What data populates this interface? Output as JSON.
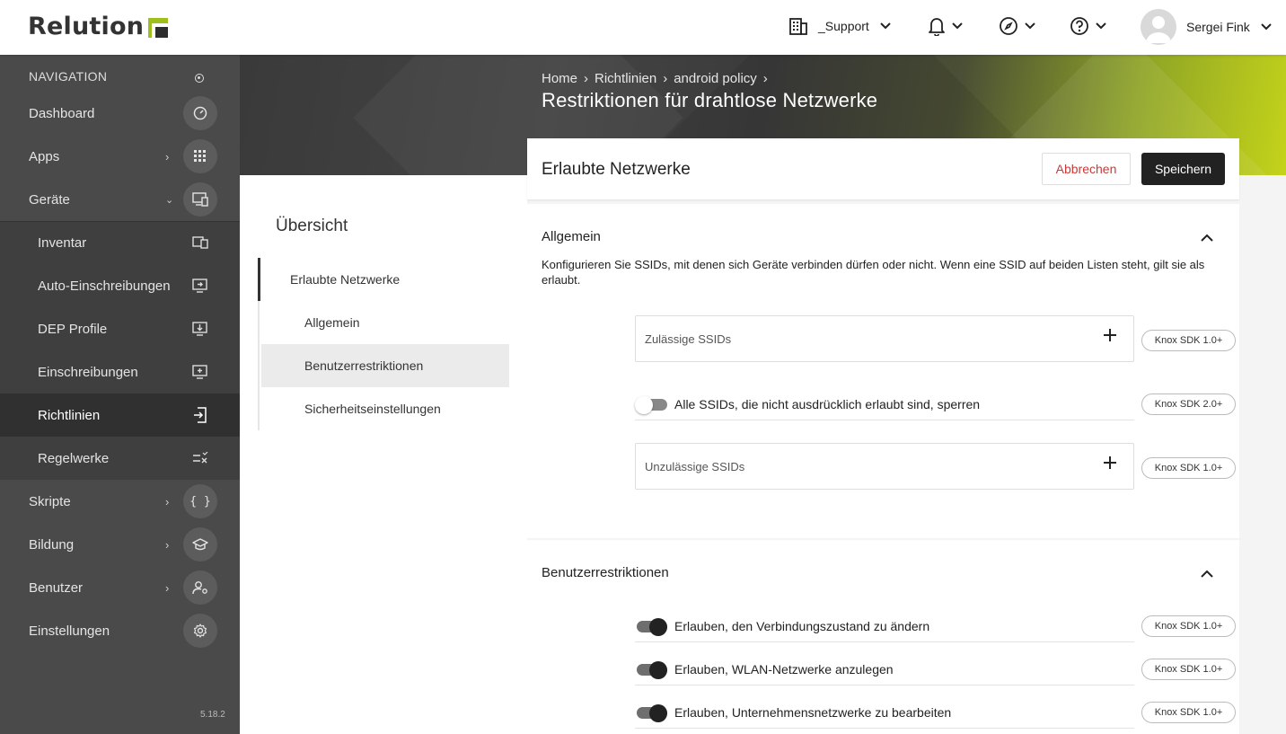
{
  "app": {
    "logo_text": "Relution",
    "version": "5.18.2"
  },
  "topbar": {
    "org_label": "_Support",
    "user_name": "Sergei Fink",
    "icons": [
      "building-icon",
      "bell-icon",
      "compass-icon",
      "help-icon",
      "avatar"
    ]
  },
  "sidebar": {
    "heading": "NAVIGATION",
    "items": [
      {
        "label": "Dashboard",
        "icon": "gauge-icon"
      },
      {
        "label": "Apps",
        "icon": "grid-icon"
      },
      {
        "label": "Geräte",
        "icon": "devices-icon"
      },
      {
        "label": "Inventar",
        "icon": "inventory-icon"
      },
      {
        "label": "Auto-Einschreibungen",
        "icon": "auto-enroll-icon"
      },
      {
        "label": "DEP Profile",
        "icon": "dep-profile-icon"
      },
      {
        "label": "Einschreibungen",
        "icon": "enrollment-icon"
      },
      {
        "label": "Richtlinien",
        "icon": "policy-icon"
      },
      {
        "label": "Regelwerke",
        "icon": "rules-icon"
      },
      {
        "label": "Skripte",
        "icon": "braces-icon"
      },
      {
        "label": "Bildung",
        "icon": "graduation-cap-icon"
      },
      {
        "label": "Benutzer",
        "icon": "user-settings-icon"
      },
      {
        "label": "Einstellungen",
        "icon": "gear-icon"
      }
    ]
  },
  "breadcrumb": [
    "Home",
    "Richtlinien",
    "android policy"
  ],
  "page_title": "Restriktionen für drahtlose Netzwerke",
  "overview": {
    "title": "Übersicht",
    "items": [
      "Erlaubte Netzwerke",
      "Allgemein",
      "Benutzerrestriktionen",
      "Sicherheitseinstellungen"
    ]
  },
  "card": {
    "title": "Erlaubte Netzwerke",
    "cancel_label": "Abbrechen",
    "save_label": "Speichern"
  },
  "general": {
    "title": "Allgemein",
    "description": "Konfigurieren Sie SSIDs, mit denen sich Geräte verbinden dürfen oder nicht. Wenn eine SSID auf beiden Listen steht, gilt sie als erlaubt.",
    "allowed_placeholder": "Zulässige SSIDs",
    "allowed_badge": "Knox SDK 1.0+",
    "block_toggle_label": "Alle SSIDs, die nicht ausdrücklich erlaubt sind, sperren",
    "block_toggle_badge": "Knox SDK 2.0+",
    "block_toggle_on": false,
    "blocked_placeholder": "Unzulässige SSIDs",
    "blocked_badge": "Knox SDK 1.0+"
  },
  "user_restrictions": {
    "title": "Benutzerrestriktionen",
    "toggles": [
      {
        "label": "Erlauben, den Verbindungszustand zu ändern",
        "badge": "Knox SDK 1.0+",
        "on": true
      },
      {
        "label": "Erlauben, WLAN-Netzwerke anzulegen",
        "badge": "Knox SDK 1.0+",
        "on": true
      },
      {
        "label": "Erlauben, Unternehmensnetzwerke zu bearbeiten",
        "badge": "Knox SDK 1.0+",
        "on": true
      }
    ]
  },
  "colors": {
    "accent": "#b8c918",
    "danger": "#c53b3b",
    "sidebar_bg": "#4a4a4a"
  }
}
